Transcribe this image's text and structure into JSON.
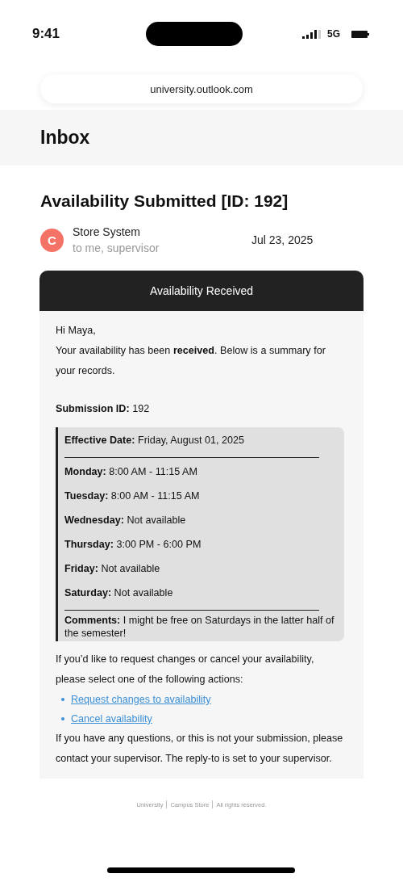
{
  "status_bar": {
    "time": "9:41",
    "network": "5G"
  },
  "address_bar": {
    "url": "university.outlook.com"
  },
  "header": {
    "title": "Inbox"
  },
  "email": {
    "subject": "Availability Submitted [ID: 192]",
    "sender": {
      "initial": "C",
      "name": "Store System",
      "recipients": "to me, supervisor",
      "color": "#f47366"
    },
    "date": "Jul 23, 2025",
    "card": {
      "banner": "Availability Received",
      "greeting": "Hi Maya,",
      "intro": "Your availability has been **received**. Below is a summary for your records.",
      "submission": "**Submission ID:** 192",
      "summary": {
        "effective": "**Effective Date:** Friday, August 01, 2025",
        "days": [
          "**Monday:** 8:00 AM - 11:15 AM",
          "**Tuesday:** 8:00 AM - 11:15 AM",
          "**Wednesday:** Not available",
          "**Thursday:** 3:00 PM - 6:00 PM",
          "**Friday:** Not available",
          "**Saturday:** Not available"
        ],
        "comments": "**Comments:** I might be free on Saturdays in the latter half of the semester!"
      },
      "actions_intro": "If you’d like to request changes or cancel your availability, please select one of the following actions:",
      "links": [
        "Request changes to availability",
        "Cancel availability"
      ],
      "closing": "If you have any questions, or this is not your submission, please contact your supervisor. The reply-to is set to your supervisor."
    },
    "footer": [
      "University",
      "Campus Store",
      "All rights reserved."
    ]
  }
}
